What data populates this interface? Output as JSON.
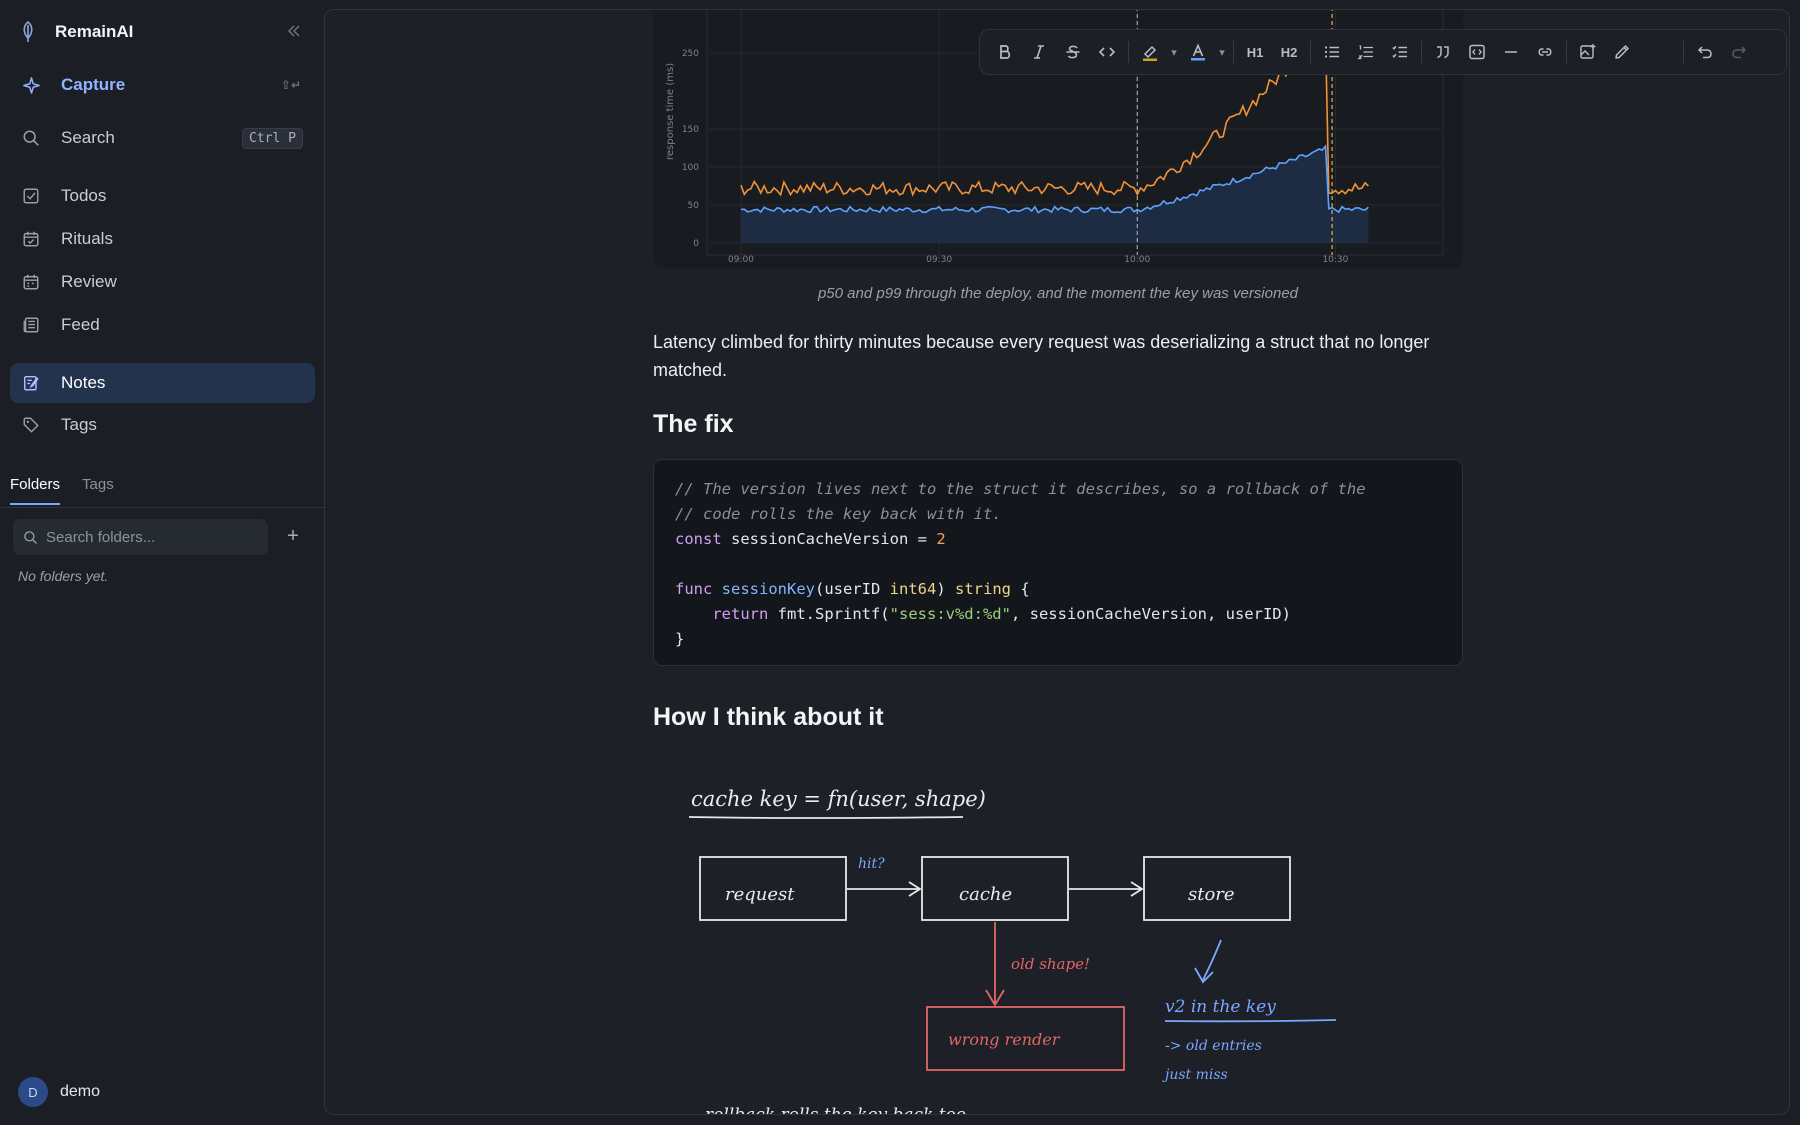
{
  "app": {
    "name": "RemainAI"
  },
  "sidebar": {
    "capture": {
      "label": "Capture",
      "shortcut": "⇧↵"
    },
    "search": {
      "label": "Search",
      "shortcut": "Ctrl P"
    },
    "items": [
      {
        "label": "Todos",
        "icon": "checkbox-icon"
      },
      {
        "label": "Rituals",
        "icon": "calendar-check-icon"
      },
      {
        "label": "Review",
        "icon": "calendar-icon"
      },
      {
        "label": "Feed",
        "icon": "newspaper-icon"
      },
      {
        "label": "Notes",
        "icon": "notes-icon",
        "active": true
      },
      {
        "label": "Tags",
        "icon": "tag-icon"
      }
    ],
    "tabs": [
      {
        "label": "Folders",
        "active": true
      },
      {
        "label": "Tags",
        "active": false
      }
    ],
    "folder_search_placeholder": "Search folders...",
    "empty_folders": "No folders yet.",
    "user": {
      "initial": "D",
      "name": "demo"
    }
  },
  "doc": {
    "caption": "p50 and p99 through the deploy, and the moment the key was versioned",
    "paragraph": "Latency climbed for thirty minutes because every request was deserializing a struct that no longer matched.",
    "heading_fix": "The fix",
    "heading_think": "How I think about it",
    "code": {
      "comment1": "// The version lives next to the struct it describes, so a rollback of the",
      "comment2": "// code rolls the key back with it.",
      "kw_const": "const",
      "var_name": " sessionCacheVersion = ",
      "num": "2",
      "kw_func": "func",
      "fn_name": "sessionKey",
      "params_open": "(userID ",
      "type_int": "int64",
      "params_close": ") ",
      "type_string": "string",
      "brace_open": " {",
      "kw_return": "return",
      "call": " fmt.Sprintf(",
      "str": "\"sess:v%d:%d\"",
      "args": ", sessionCacheVersion, userID)",
      "brace_close": "}"
    },
    "sketch": {
      "title": "cache key = fn(user, shape)",
      "box_request": "request",
      "box_cache": "cache",
      "box_store": "store",
      "hit_label": "hit?",
      "old_shape": "old shape!",
      "wrong_render": "wrong render",
      "v2_label": "v2 in the key",
      "old_entries": "-> old entries",
      "just_miss": "just miss",
      "rollback": "rollback rolls the key back too"
    }
  },
  "toolbar": {
    "h1": "H1",
    "h2": "H2"
  },
  "chart_data": {
    "type": "line",
    "title": "",
    "xlabel": "",
    "ylabel": "response time (ms)",
    "x_ticks": [
      "09:00",
      "09:30",
      "10:00",
      "10:30"
    ],
    "y_ticks": [
      0,
      50,
      100,
      150,
      250
    ],
    "ylim": [
      0,
      260
    ],
    "series": [
      {
        "name": "p50",
        "color": "#5ea2ff",
        "shape": "flat ~45ms 09:00-10:00, ramp to ~125ms at 10:30, drop back to ~45ms",
        "fill": true
      },
      {
        "name": "p99",
        "color": "#f0923a",
        "shape": "flat ~70ms 09:00-10:00, climbs above 250ms before 10:30, drop back to ~75ms"
      }
    ],
    "markers": [
      {
        "x": "10:00",
        "style": "dashed",
        "color": "#a0a4ab"
      },
      {
        "x": "10:30",
        "style": "dashed",
        "color": "#e0b34a"
      }
    ],
    "grid": true,
    "colors": {
      "p50": "#5ea2ff",
      "p99": "#f0923a",
      "marker": "#e0b34a"
    }
  },
  "colors": {
    "accent": "#8fb3ff",
    "active_bg": "#24334d",
    "sketch_red": "#e06666",
    "sketch_blue": "#7aa7ff"
  }
}
